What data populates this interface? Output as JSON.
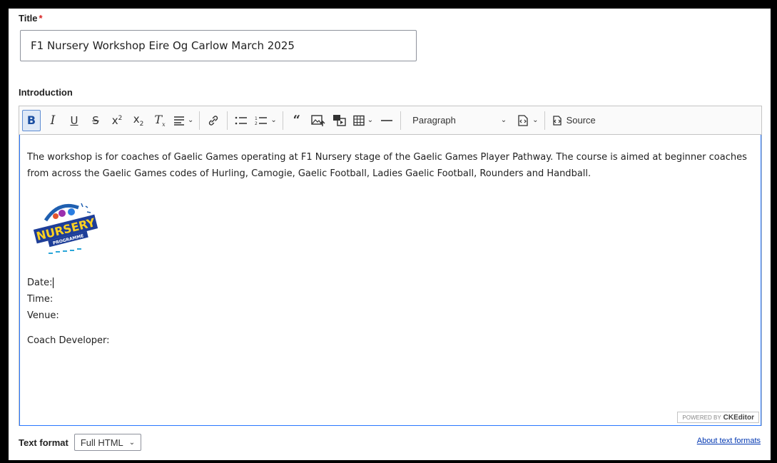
{
  "title_field": {
    "label": "Title",
    "required_mark": "*",
    "value": "F1 Nursery Workshop Eire Og Carlow March 2025"
  },
  "introduction": {
    "label": "Introduction",
    "toolbar": {
      "heading_select": "Paragraph",
      "source_label": "Source",
      "icons": [
        "bold-icon",
        "italic-icon",
        "underline-icon",
        "strikethrough-icon",
        "superscript-icon",
        "subscript-icon",
        "remove-format-icon",
        "align-icon",
        "link-icon",
        "bulleted-list-icon",
        "numbered-list-icon",
        "blockquote-icon",
        "insert-image-icon",
        "media-icon",
        "table-icon",
        "horizontal-line-icon",
        "code-block-icon",
        "source-icon"
      ]
    },
    "body": {
      "paragraph": "The workshop is for coaches of Gaelic Games operating at F1 Nursery stage of the Gaelic Games Player Pathway. The course is aimed at beginner coaches from across the Gaelic Games codes of Hurling, Camogie, Gaelic Football, Ladies Gaelic Football, Rounders and Handball.",
      "logo_text": "NURSERY",
      "logo_subtext": "PROGRAMME",
      "date_label": "Date:",
      "time_label": "Time:",
      "venue_label": "Venue:",
      "coach_label": "Coach Developer:"
    },
    "powered_by": "POWERED BY",
    "powered_brand": "CKEditor"
  },
  "text_format": {
    "label": "Text format",
    "selected": "Full HTML",
    "about_link": "About text formats"
  },
  "colors": {
    "focus_border": "#2977ff",
    "active_button_bg": "#dfe9f7",
    "link": "#0036b1",
    "required": "#d72222"
  }
}
